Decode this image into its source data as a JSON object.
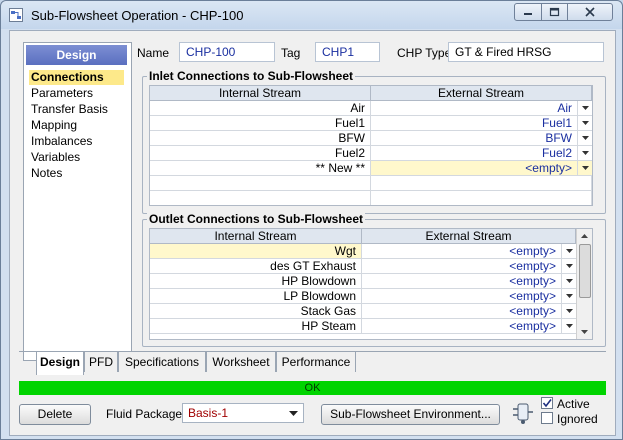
{
  "window": {
    "title": "Sub-Flowsheet Operation - CHP-100"
  },
  "sidebar": {
    "header": "Design",
    "items": [
      {
        "label": "Connections",
        "selected": true
      },
      {
        "label": "Parameters"
      },
      {
        "label": "Transfer Basis"
      },
      {
        "label": "Mapping"
      },
      {
        "label": "Imbalances"
      },
      {
        "label": "Variables"
      },
      {
        "label": "Notes"
      }
    ]
  },
  "header": {
    "name_label": "Name",
    "name_value": "CHP-100",
    "tag_label": "Tag",
    "tag_value": "CHP1",
    "chp_type_label": "CHP Type",
    "chp_type_value": "GT & Fired HRSG"
  },
  "inlet": {
    "title": "Inlet Connections to Sub-Flowsheet",
    "col_internal": "Internal Stream",
    "col_external": "External Stream",
    "rows": [
      {
        "internal": "Air",
        "external": "Air"
      },
      {
        "internal": "Fuel1",
        "external": "Fuel1"
      },
      {
        "internal": "BFW",
        "external": "BFW"
      },
      {
        "internal": "Fuel2",
        "external": "Fuel2"
      },
      {
        "internal": "** New **",
        "external": "<empty>"
      }
    ]
  },
  "outlet": {
    "title": "Outlet Connections to Sub-Flowsheet",
    "col_internal": "Internal Stream",
    "col_external": "External Stream",
    "rows": [
      {
        "internal": "Wgt",
        "external": "<empty>"
      },
      {
        "internal": "des GT Exhaust",
        "external": "<empty>"
      },
      {
        "internal": "HP Blowdown",
        "external": "<empty>"
      },
      {
        "internal": "LP Blowdown",
        "external": "<empty>"
      },
      {
        "internal": "Stack Gas",
        "external": "<empty>"
      },
      {
        "internal": "HP Steam",
        "external": "<empty>"
      }
    ]
  },
  "tabs": [
    "Design",
    "PFD",
    "Specifications",
    "Worksheet",
    "Performance"
  ],
  "status": "OK",
  "footer": {
    "delete_label": "Delete",
    "fluid_package_label": "Fluid Package",
    "fluid_package_value": "Basis-1",
    "env_button_label": "Sub-Flowsheet Environment...",
    "active_label": "Active",
    "ignored_label": "Ignored",
    "active_checked": true,
    "ignored_checked": false
  },
  "colors": {
    "accent": "#5a6fc0",
    "status_ok": "#00d400",
    "link_blue": "#1a2fa0"
  }
}
